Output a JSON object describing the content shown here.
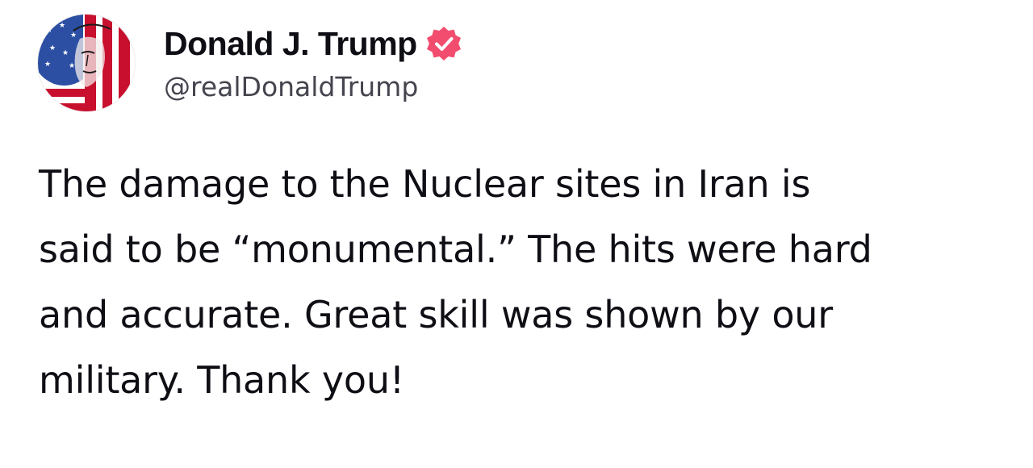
{
  "author": {
    "display_name": "Donald J. Trump",
    "handle": "@realDonaldTrump",
    "verified_badge_color": "#f24d6f",
    "avatar_colors": [
      "#c8102e",
      "#2c4fa3",
      "#ffffff"
    ]
  },
  "post": {
    "lines": [
      "The damage to the Nuclear sites in Iran is",
      "said to be “monumental.” The hits were hard",
      "and accurate. Great skill was shown by our",
      "military. Thank you!"
    ]
  },
  "colors": {
    "text": "#0e0e15",
    "handle": "#45454f",
    "background": "#ffffff"
  }
}
